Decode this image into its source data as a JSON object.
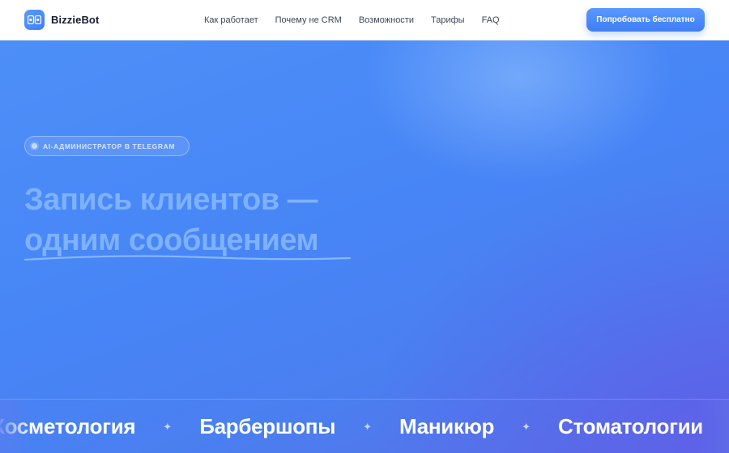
{
  "header": {
    "brand": "BizzieBot",
    "logo_icon": "bot-icon",
    "nav": [
      {
        "label": "Как работает"
      },
      {
        "label": "Почему не CRM"
      },
      {
        "label": "Возможности"
      },
      {
        "label": "Тарифы"
      },
      {
        "label": "FAQ"
      }
    ],
    "cta_label": "Попробовать бесплатно"
  },
  "hero": {
    "badge": "AI-АДМИНИСТРАТОР В TELEGRAM",
    "headline_line1": "Запись клиентов —",
    "headline_line2": "одним сообщением"
  },
  "strip": {
    "items": [
      "Косметология",
      "Барбершопы",
      "Маникюр",
      "Стоматологии"
    ],
    "separator": "✦"
  },
  "colors": {
    "accent": "#4a8af8",
    "brand_text": "#151a2d",
    "nav_text": "#3e4558",
    "headline": "#7eb1ff"
  }
}
